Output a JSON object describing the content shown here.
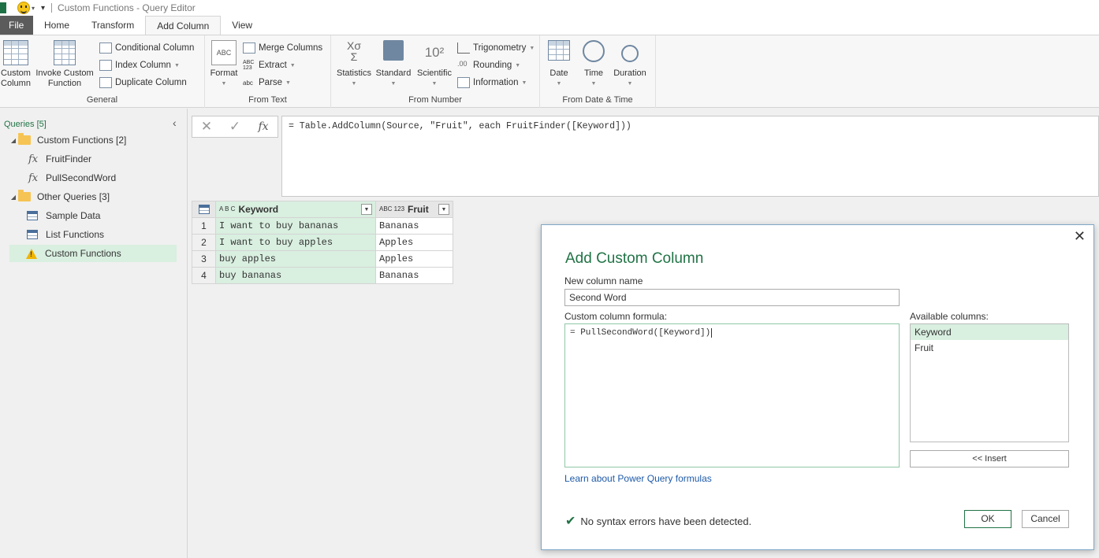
{
  "window": {
    "title": "Custom Functions - Query Editor",
    "menu_glyph": "▾"
  },
  "tabs": [
    {
      "label": "File"
    },
    {
      "label": "Home"
    },
    {
      "label": "Transform"
    },
    {
      "label": "Add Column"
    },
    {
      "label": "View"
    }
  ],
  "ribbon": {
    "general": {
      "label": "General",
      "custom_column_l1": "Custom",
      "custom_column_l2": "Column",
      "invoke_l1": "Invoke Custom",
      "invoke_l2": "Function",
      "conditional": "Conditional Column",
      "index": "Index Column",
      "duplicate": "Duplicate Column"
    },
    "from_text": {
      "label": "From Text",
      "format": "Format",
      "merge": "Merge Columns",
      "extract": "Extract",
      "parse": "Parse",
      "extract_icon": "ABC\n123",
      "parse_icon": "abc"
    },
    "from_number": {
      "label": "From Number",
      "statistics": "Statistics",
      "standard": "Standard",
      "scientific": "Scientific",
      "trigonometry": "Trigonometry",
      "rounding": "Rounding",
      "information": "Information",
      "stat_icon": "Xσ\nΣ",
      "sci_icon": "10²"
    },
    "from_datetime": {
      "label": "From Date & Time",
      "date": "Date",
      "time": "Time",
      "duration": "Duration"
    }
  },
  "queries": {
    "header": "Queries [5]",
    "groups": [
      {
        "label": "Custom Functions [2]",
        "items": [
          "FruitFinder",
          "PullSecondWord"
        ]
      },
      {
        "label": "Other Queries [3]",
        "items": [
          "Sample Data",
          "List Functions",
          "Custom Functions"
        ]
      }
    ]
  },
  "formula_bar": {
    "formula": "= Table.AddColumn(Source, \"Fruit\", each FruitFinder([Keyword]))"
  },
  "grid": {
    "columns": [
      {
        "name": "Keyword",
        "type": "A B C"
      },
      {
        "name": "Fruit",
        "type": "ABC 123"
      }
    ],
    "rows": [
      {
        "n": "1",
        "keyword": "I want to buy bananas",
        "fruit": "Bananas"
      },
      {
        "n": "2",
        "keyword": "I want to buy apples",
        "fruit": "Apples"
      },
      {
        "n": "3",
        "keyword": "buy apples",
        "fruit": "Apples"
      },
      {
        "n": "4",
        "keyword": "buy bananas",
        "fruit": "Bananas"
      }
    ]
  },
  "dialog": {
    "title": "Add Custom Column",
    "new_col_label": "New column name",
    "new_col_value": "Second Word",
    "formula_label": "Custom column formula:",
    "formula_value": "= PullSecondWord([Keyword])",
    "available_label": "Available columns:",
    "available": [
      "Keyword",
      "Fruit"
    ],
    "insert": "<< Insert",
    "learn": "Learn about Power Query formulas",
    "status": "No syntax errors have been detected.",
    "ok": "OK",
    "cancel": "Cancel"
  },
  "colors": {
    "accent": "#217346",
    "selection": "#d9efe0",
    "link": "#1e5aa8"
  }
}
